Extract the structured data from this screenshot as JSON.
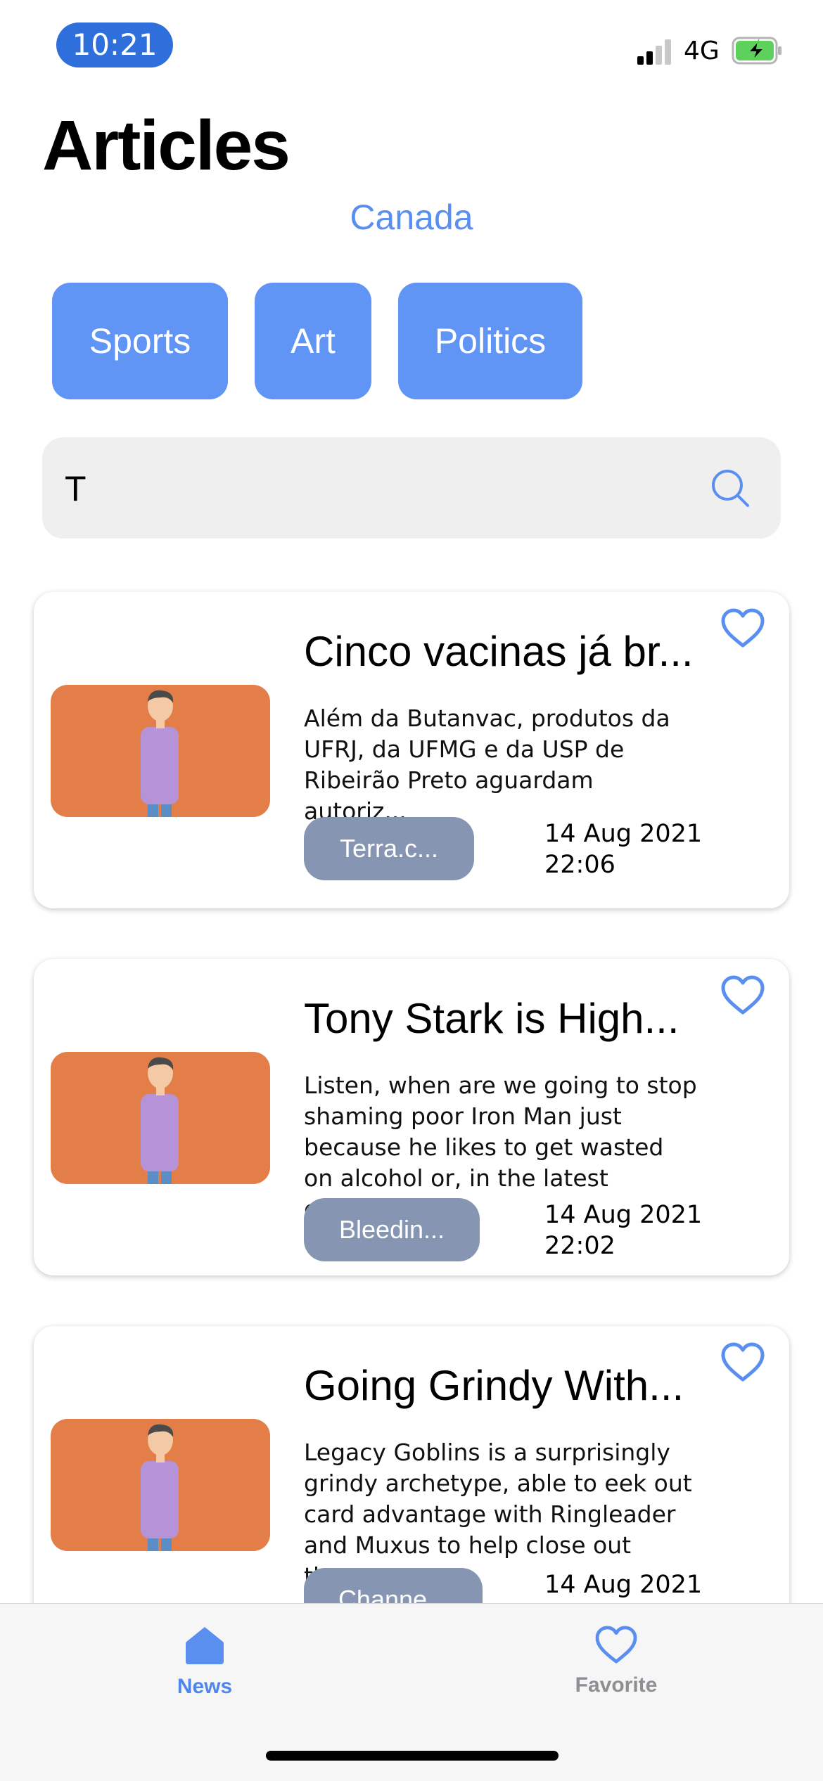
{
  "status_bar": {
    "time": "10:21",
    "network": "4G"
  },
  "header": {
    "title": "Articles",
    "country": "Canada"
  },
  "categories": [
    "Sports",
    "Art",
    "Politics"
  ],
  "search": {
    "value": "T"
  },
  "articles": [
    {
      "title": "Cinco vacinas já br...",
      "description": "Além da Butanvac, produtos da UFRJ, da UFMG e da USP de Ribeirão Preto aguardam autoriz...",
      "source": "Terra.c...",
      "date": "14 Aug 2021",
      "time": "22:06"
    },
    {
      "title": "Tony Stark is High...",
      "description": "Listen, when are we going to stop shaming poor Iron Man just because he likes to get wasted on alcohol or, in the latest cartoonis...",
      "source": "Bleedin...",
      "date": "14 Aug 2021",
      "time": "22:02"
    },
    {
      "title": "Going Grindy With...",
      "description": "Legacy Goblins is a surprisingly grindy archetype, able to eek out card advantage with Ringleader and Muxus to help close out the...",
      "source": "Channe...",
      "date": "14 Aug 2021",
      "time": ""
    }
  ],
  "tabs": {
    "news": "News",
    "favorite": "Favorite"
  },
  "colors": {
    "accent": "#6195f5",
    "source_badge": "#8695b1",
    "thumbnail_bg": "#e47e48",
    "tab_inactive": "#8e8e93"
  }
}
